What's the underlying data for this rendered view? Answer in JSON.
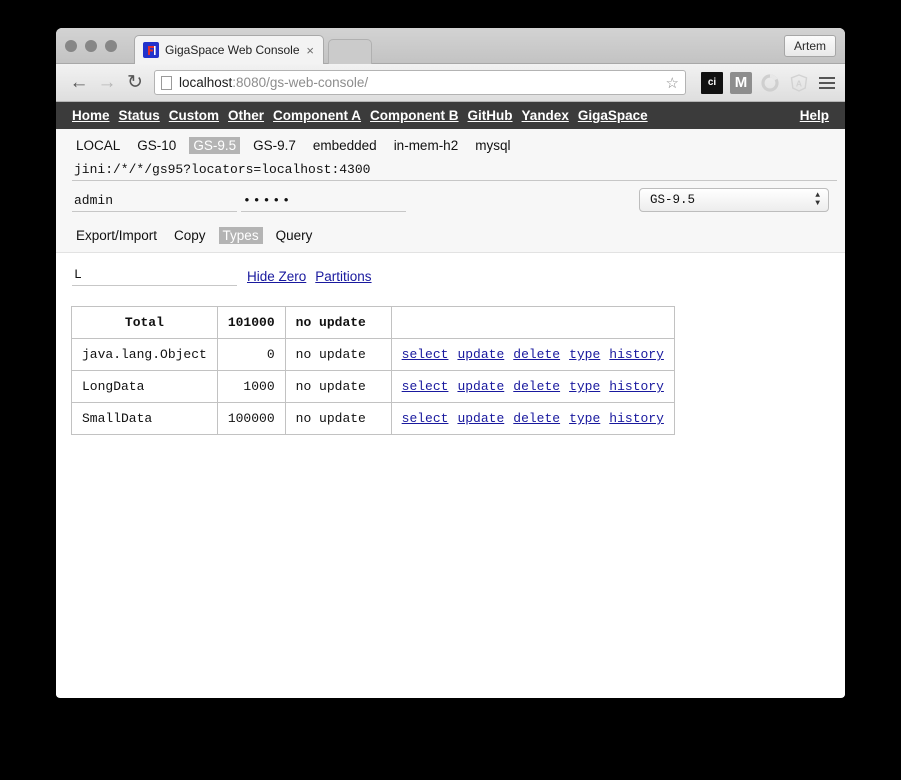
{
  "window": {
    "profile_label": "Artem",
    "tab": {
      "title": "GigaSpace Web Console",
      "title_dim": "1.",
      "close_glyph": "×",
      "favicon_name": "gigaspace-favicon"
    },
    "toolbar": {
      "back_glyph": "←",
      "forward_glyph": "→",
      "reload_glyph": "↻",
      "url_host": "localhost",
      "url_rest": ":8080/gs-web-console/",
      "star_glyph": "☆",
      "ext_ci_label": "ci",
      "ext_m_label": "M",
      "ext_circle_label": "",
      "ext_angular_label": "A"
    }
  },
  "site_nav": {
    "links": [
      "Home",
      "Status",
      "Custom",
      "Other",
      "Component A",
      "Component B",
      "GitHub",
      "Yandex",
      "GigaSpace"
    ],
    "help": "Help"
  },
  "spaces": {
    "items": [
      "LOCAL",
      "GS-10",
      "GS-9.5",
      "GS-9.7",
      "embedded",
      "in-mem-h2",
      "mysql"
    ],
    "active": "GS-9.5"
  },
  "connection": {
    "locator": "jini:/*/*/gs95?locators=localhost:4300",
    "locator_placeholder": "",
    "username": "admin",
    "username_placeholder": "",
    "password": "•••••",
    "password_placeholder": "",
    "version_selected": "GS-9.5",
    "arrow_up": "▲",
    "arrow_down": "▼"
  },
  "view_tabs": {
    "items": [
      "Export/Import",
      "Copy",
      "Types",
      "Query"
    ],
    "active": "Types"
  },
  "filter": {
    "value": "L",
    "placeholder": "",
    "links": [
      "Hide Zero",
      "Partitions"
    ]
  },
  "types_table": {
    "total_row": {
      "name": "Total",
      "count": "101000",
      "update": "no update",
      "actions": []
    },
    "rows": [
      {
        "name": "java.lang.Object",
        "count": "0",
        "update": "no update",
        "actions": [
          "select",
          "update",
          "delete",
          "type",
          "history"
        ]
      },
      {
        "name": "LongData",
        "count": "1000",
        "update": "no update",
        "actions": [
          "select",
          "update",
          "delete",
          "type",
          "history"
        ]
      },
      {
        "name": "SmallData",
        "count": "100000",
        "update": "no update",
        "actions": [
          "select",
          "update",
          "delete",
          "type",
          "history"
        ]
      }
    ]
  },
  "colors": {
    "navbar": "#3b3b3b",
    "active_pill": "#b4b4b4",
    "link": "#19199e",
    "page_bg": "#000000"
  }
}
